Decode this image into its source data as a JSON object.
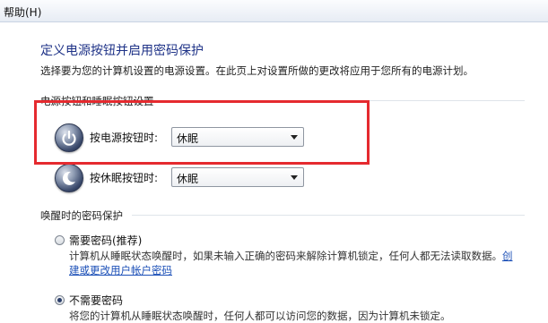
{
  "menubar": {
    "help": "帮助(H)"
  },
  "page": {
    "title": "定义电源按钮并启用密码保护",
    "description": "选择要为您的计算机设置的电源设置。在此页上对设置所做的更改将应用于您所有的电源计划。"
  },
  "buttons_section": {
    "label": "电源按钮和睡眠按钮设置",
    "power_button": {
      "label": "按电源按钮时:",
      "value": "休眠"
    },
    "sleep_button": {
      "label": "按休眠按钮时:",
      "value": "休眠"
    }
  },
  "wake_section": {
    "label": "唤醒时的密码保护",
    "require_password": {
      "title": "需要密码(推荐)",
      "desc_line1": "计算机从睡眠状态唤醒时，如果未输入正确的密码来解除计算机锁定，任何人都无法读取数据。",
      "link_part1": "创",
      "link_part2": "建或更改用户帐户密码",
      "checked": false
    },
    "no_password": {
      "title": "不需要密码",
      "desc_line1": "将您的计算机从睡眠状态唤醒时，任何人都可以访问您的数据，因为计算机未锁定。",
      "checked": true
    }
  },
  "colors": {
    "title": "#1e3287",
    "link": "#1b4fb7",
    "highlight": "#e52a2f"
  }
}
